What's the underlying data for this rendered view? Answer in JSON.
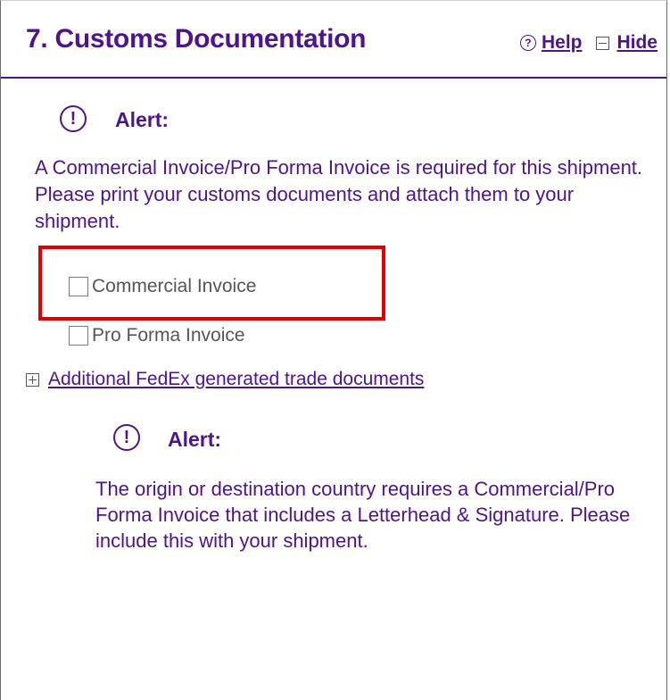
{
  "section": {
    "title": "7. Customs Documentation",
    "help_label": "Help",
    "hide_label": "Hide"
  },
  "alert_primary": {
    "title": "Alert:",
    "message": "A Commercial Invoice/Pro Forma Invoice is required for this shipment. Please print your customs documents and attach them to your shipment."
  },
  "documents": [
    {
      "label": "Commercial Invoice",
      "checked": false
    },
    {
      "label": "Pro Forma Invoice",
      "checked": false
    }
  ],
  "additional_docs": {
    "label": "Additional FedEx generated trade documents"
  },
  "alert_secondary": {
    "title": "Alert:",
    "message": "The origin or destination country requires a Commercial/Pro Forma Invoice that includes a Letterhead & Signature. Please include this with your shipment."
  },
  "colors": {
    "brand_purple": "#4d148c",
    "highlight_red": "#e00000"
  }
}
